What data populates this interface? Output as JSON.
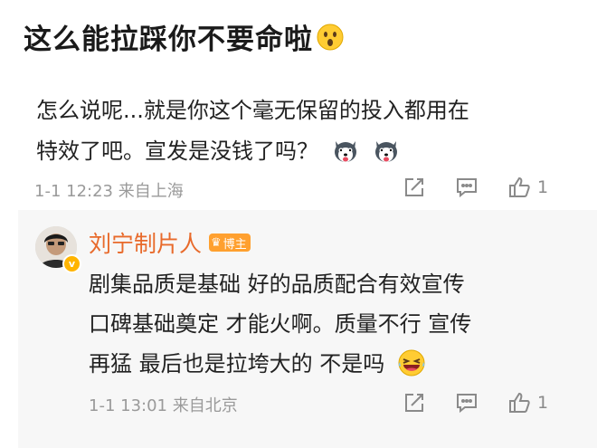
{
  "post": {
    "title": "这么能拉踩你不要命啦"
  },
  "comment": {
    "lines": [
      "怎么说呢...就是你这个毫无保留的投入都用在",
      "特效了吧。宣发是没钱了吗？"
    ],
    "timestamp": "1-1 12:23",
    "location": "来自上海",
    "like_count": "1"
  },
  "reply": {
    "author": "刘宁制片人",
    "badge": "博主",
    "lines": [
      "剧集品质是基础 好的品质配合有效宣传",
      "口碑基础奠定 才能火啊。质量不行 宣传",
      "再猛 最后也是拉垮大的 不是吗"
    ],
    "timestamp": "1-1 13:01",
    "location": "来自北京",
    "like_count": "1"
  },
  "icons": {
    "title_emoji": "surprised-face-icon",
    "comment_emoji": "husky-dog-icon",
    "reply_emoji": "laughing-face-icon",
    "share": "share-icon",
    "comment": "comment-icon",
    "like": "thumbs-up-icon"
  },
  "colors": {
    "author": "#e86a2b",
    "badge": "#ffa02f",
    "meta": "#9a9a9a"
  }
}
